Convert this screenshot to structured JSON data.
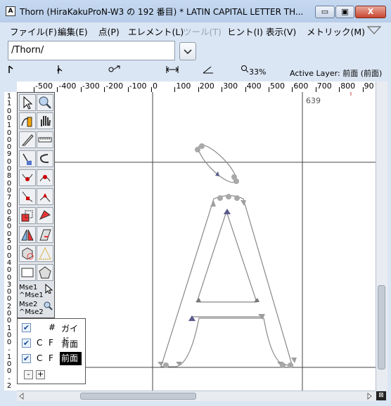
{
  "window": {
    "title": "Thorn (HiraKakuProN-W3 の 192 番目) * LATIN CAPITAL LETTER TH...",
    "app_icon": "A",
    "minimize_label": "▭",
    "maximize_label": "▣",
    "close_label": "X"
  },
  "menu": {
    "items": [
      {
        "label": "ファイル(F)",
        "enabled": true
      },
      {
        "label": "編集(E)",
        "enabled": true
      },
      {
        "label": "点(P)",
        "enabled": true
      },
      {
        "label": "エレメント(L)",
        "enabled": true
      },
      {
        "label": "ツール(T)",
        "enabled": false
      },
      {
        "label": "ヒント(I)",
        "enabled": true
      },
      {
        "label": "表示(V)",
        "enabled": true
      },
      {
        "label": "メトリック(M)",
        "enabled": true
      }
    ]
  },
  "path_field": {
    "value": "/Thorn/"
  },
  "status": {
    "zoom": "33%",
    "active_layer": "Active Layer: 前面 (前面)"
  },
  "ruler": {
    "top_labels": [
      "-500",
      "-400",
      "-300",
      "-200",
      "-100",
      "0",
      "100",
      "200",
      "300",
      "400",
      "500",
      "600",
      "700",
      "800",
      "90"
    ],
    "left_labels": [
      "1",
      "1",
      "0",
      "0",
      "1",
      "0",
      "0",
      "0",
      "9",
      "0",
      "0",
      "8",
      "0",
      "0",
      "7",
      "0",
      "0",
      "6",
      "0",
      "0",
      "5",
      "0",
      "0",
      "4",
      "0",
      "0",
      "3",
      "0",
      "0",
      "2",
      "0",
      "0",
      "1",
      "0",
      "0",
      "-",
      "1",
      "0",
      "0",
      "-",
      "2"
    ]
  },
  "canvas": {
    "width_label": "639"
  },
  "tools": {
    "mse_lines": [
      "Mse1",
      "^Mse1",
      "Mse2",
      "^Mse2"
    ]
  },
  "layers": {
    "rows": [
      {
        "checked": true,
        "c": "",
        "f": "#",
        "name": "ガイド",
        "selected": false
      },
      {
        "checked": true,
        "c": "C",
        "f": "F",
        "name": "背面",
        "selected": false
      },
      {
        "checked": true,
        "c": "C",
        "f": "F",
        "name": "前面",
        "selected": true
      }
    ],
    "minus_label": "-",
    "plus_label": "+"
  },
  "colors": {
    "outline": "#8a8a8a",
    "point": "#9d9d9d",
    "selected_point": "#5a5a8c",
    "guide": "#444444"
  }
}
